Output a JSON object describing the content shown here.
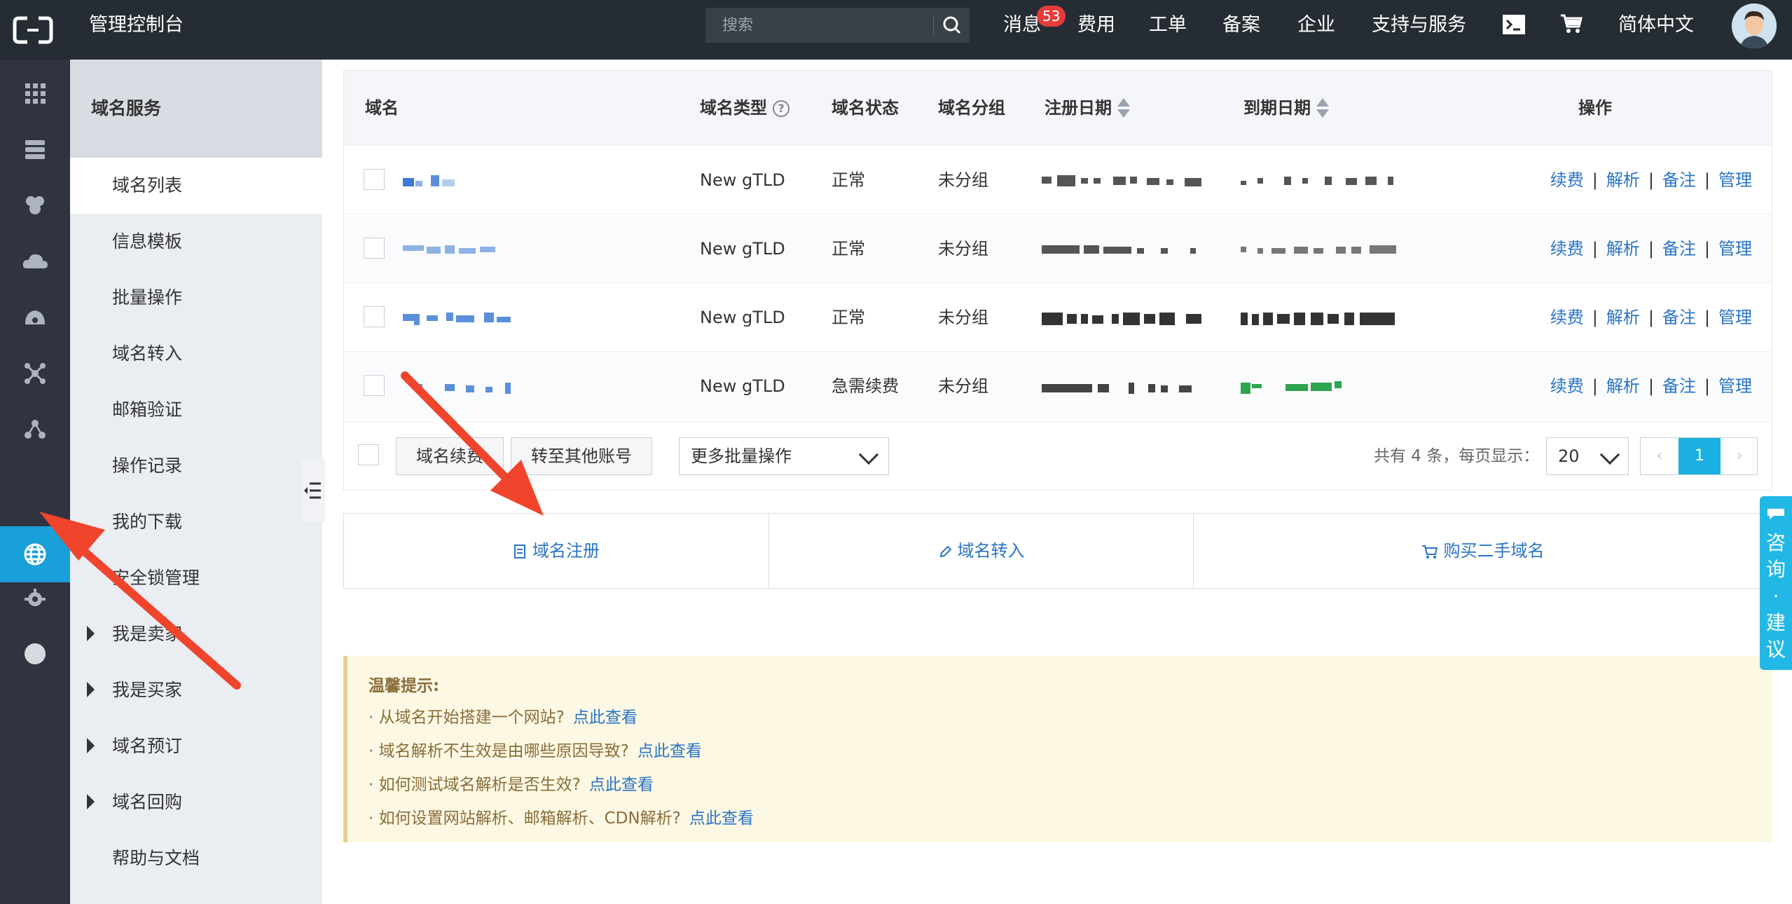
{
  "topbar": {
    "title": "管理控制台",
    "search_placeholder": "搜索",
    "nav": [
      "消息",
      "费用",
      "工单",
      "备案",
      "企业",
      "支持与服务",
      "简体中文"
    ],
    "message_badge": "53"
  },
  "sidebar": {
    "title": "域名服务",
    "items": [
      "域名列表",
      "信息模板",
      "批量操作",
      "域名转入",
      "邮箱验证",
      "操作记录",
      "我的下载",
      "安全锁管理",
      "我是卖家",
      "我是买家",
      "域名预订",
      "域名回购",
      "帮助与文档"
    ]
  },
  "table": {
    "headers": [
      "域名",
      "域名类型",
      "域名状态",
      "域名分组",
      "注册日期",
      "到期日期",
      "操作"
    ],
    "rows": [
      {
        "type": "New gTLD",
        "status": "正常",
        "group": "未分组"
      },
      {
        "type": "New gTLD",
        "status": "正常",
        "group": "未分组"
      },
      {
        "type": "New gTLD",
        "status": "正常",
        "group": "未分组"
      },
      {
        "type": "New gTLD",
        "status": "急需续费",
        "group": "未分组"
      }
    ],
    "ops": [
      "续费",
      "解析",
      "备注",
      "管理"
    ]
  },
  "footer": {
    "btn_renew": "域名续费",
    "btn_transfer": "转至其他账号",
    "batch_select": "更多批量操作",
    "total": "共有 4 条，每页显示：",
    "page_size": "20",
    "page_prev": "‹",
    "current_page": "1",
    "page_next": "›"
  },
  "actions": [
    "域名注册",
    "域名转入",
    "购买二手域名"
  ],
  "tips": {
    "title": "温馨提示:",
    "items": [
      "· 从域名开始搭建一个网站?",
      "· 域名解析不生效是由哪些原因导致?",
      "· 如何测试域名解析是否生效?",
      "· 如何设置网站解析、邮箱解析、CDN解析?"
    ],
    "link": "点此查看"
  },
  "consult": [
    "咨",
    "询",
    "·",
    "建",
    "议"
  ],
  "colors": {
    "topbar": "#262c33",
    "rail": "#2f3440",
    "accent": "#19a0d8",
    "link": "#2a74c6",
    "arrow": "#f0442d"
  }
}
